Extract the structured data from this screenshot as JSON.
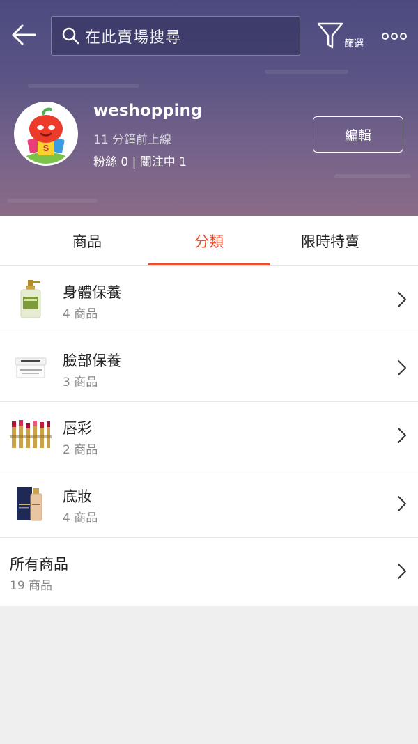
{
  "header": {
    "search_placeholder": "在此賣場搜尋",
    "filter_label": "篩選",
    "shop_name": "weshopping",
    "last_online": "11 分鐘前上線",
    "follow_info": "粉絲 0 | 關注中 1",
    "edit_label": "編輯"
  },
  "tabs": [
    {
      "label": "商品"
    },
    {
      "label": "分類"
    },
    {
      "label": "限時特賣"
    }
  ],
  "categories": [
    {
      "title": "身體保養",
      "count": "4 商品",
      "thumb": "lotion-bottle-icon"
    },
    {
      "title": "臉部保養",
      "count": "3 商品",
      "thumb": "cream-jar-icon"
    },
    {
      "title": "唇彩",
      "count": "2 商品",
      "thumb": "lipsticks-icon"
    },
    {
      "title": "底妝",
      "count": "4 商品",
      "thumb": "foundation-icon"
    },
    {
      "title": "所有商品",
      "count": "19 商品"
    }
  ],
  "colors": {
    "accent": "#ee4d2d",
    "header_top": "#4b4a7f",
    "header_bottom": "#8a6b87"
  }
}
